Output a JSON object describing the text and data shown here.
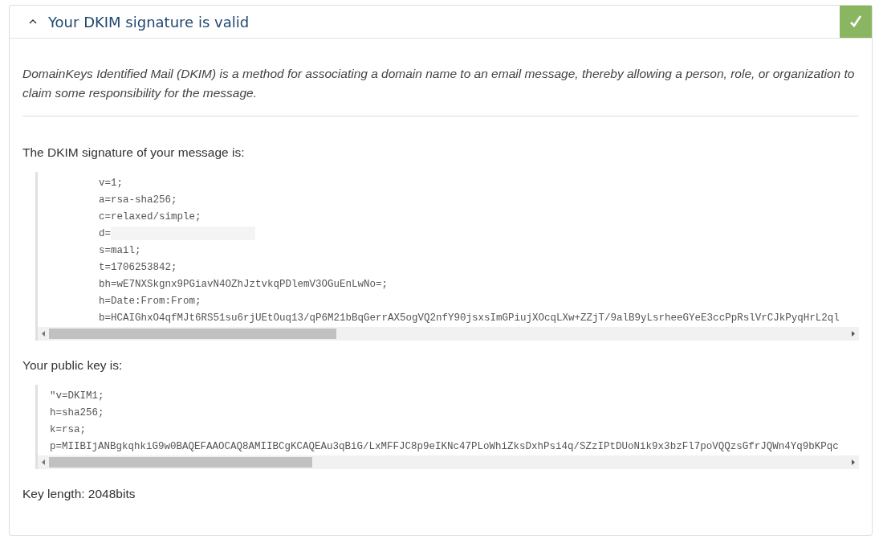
{
  "panel": {
    "title": "Your DKIM signature is valid",
    "expanded": true,
    "valid": true,
    "description": "DomainKeys Identified Mail (DKIM) is a method for associating a domain name to an email message, thereby allowing a person, role, or organization to claim some responsibility for the message.",
    "signature_label": "The DKIM signature of your message is:",
    "signature_lines": [
      "v=1;",
      "a=rsa-sha256;",
      "c=relaxed/simple;",
      "d=",
      "s=mail;",
      "t=1706253842;",
      "bh=wE7NXSkgnx9PGiavN4OZhJztvkqPDlemV3OGuEnLwNo=;",
      "h=Date:From:From;",
      "b=HCAIGhxO4qfMJt6RS51su6rjUEtOuq13/qP6M21bBqGerrAX5ogVQ2nfY90jsxsImGPiujXOcqLXw+ZZjT/9alB9yLsrheeGYeE3ccPpRslVrCJkPyqHrL2ql"
    ],
    "public_key_label": "Your public key is:",
    "public_key_lines": [
      "\"v=DKIM1;",
      "h=sha256;",
      "k=rsa;",
      "p=MIIBIjANBgkqhkiG9w0BAQEFAAOCAQ8AMIIBCgKCAQEAu3qBiG/LxMFFJC8p9eIKNc47PLoWhiZksDxhPsi4q/SZzIPtDUoNik9x3bzFl7poVQQzsGfrJQWn4Yq9bKPqc"
    ],
    "key_length": "Key length: 2048bits"
  }
}
